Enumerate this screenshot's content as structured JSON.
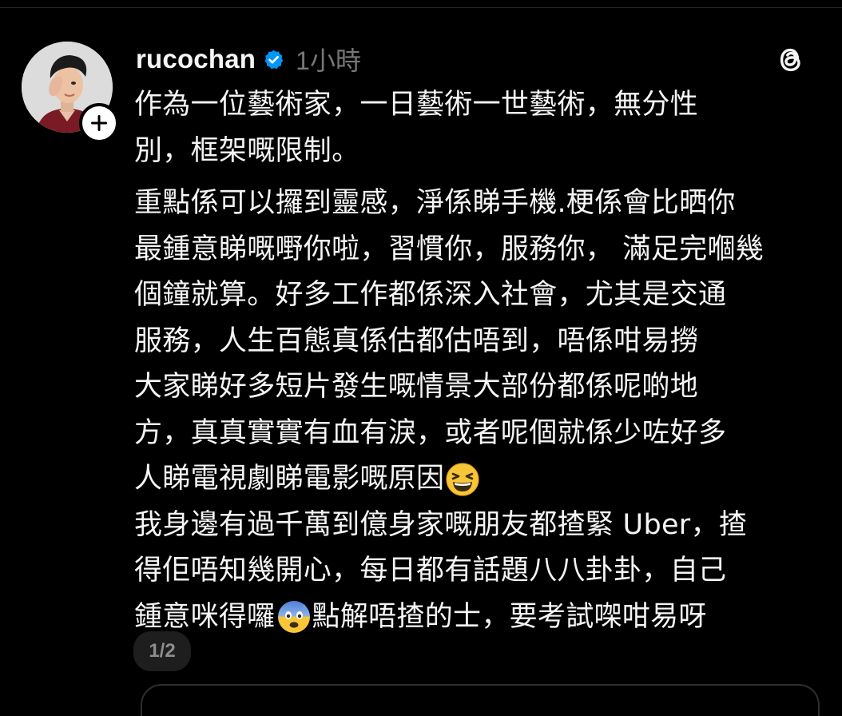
{
  "post": {
    "username": "rucochan",
    "timestamp": "1小時",
    "lines": [
      "作為一位藝術家，一日藝術一世藝術，無分性",
      "別，框架嘅限制。",
      "重點係可以攞到靈感，淨係睇手機.梗係會比晒你",
      "最鍾意睇嘅嘢你啦，習慣你，服務你， 滿足完嗰幾",
      "個鐘就算。好多工作都係深入社會，尤其是交通",
      "服務，人生百態真係估都估唔到，唔係咁易撈",
      "大家睇好多短片發生嘅情景大部份都係呢啲地",
      "方，真真實實有血有淚，或者呢個就係少咗好多",
      "人睇電視劇睇電影嘅原因",
      "我身邊有過千萬到億身家嘅朋友都揸緊 Uber，揸",
      "得佢唔知幾開心，每日都有話題八八卦卦，自己",
      "鍾意咪得囉",
      "點解唔揸的士，要考試㗎咁易呀"
    ],
    "emojis": [
      "grinning-squinting-face-emoji",
      "anxious-face-with-sweat-emoji"
    ],
    "page_indicator": "1/2"
  },
  "icons": {
    "follow": "plus-icon",
    "verified": "verified-badge-icon",
    "app_logo": "threads-logo-icon"
  },
  "colors": {
    "background": "#000000",
    "text": "#f5f5f5",
    "muted": "#777777",
    "verified": "#0095f6"
  }
}
